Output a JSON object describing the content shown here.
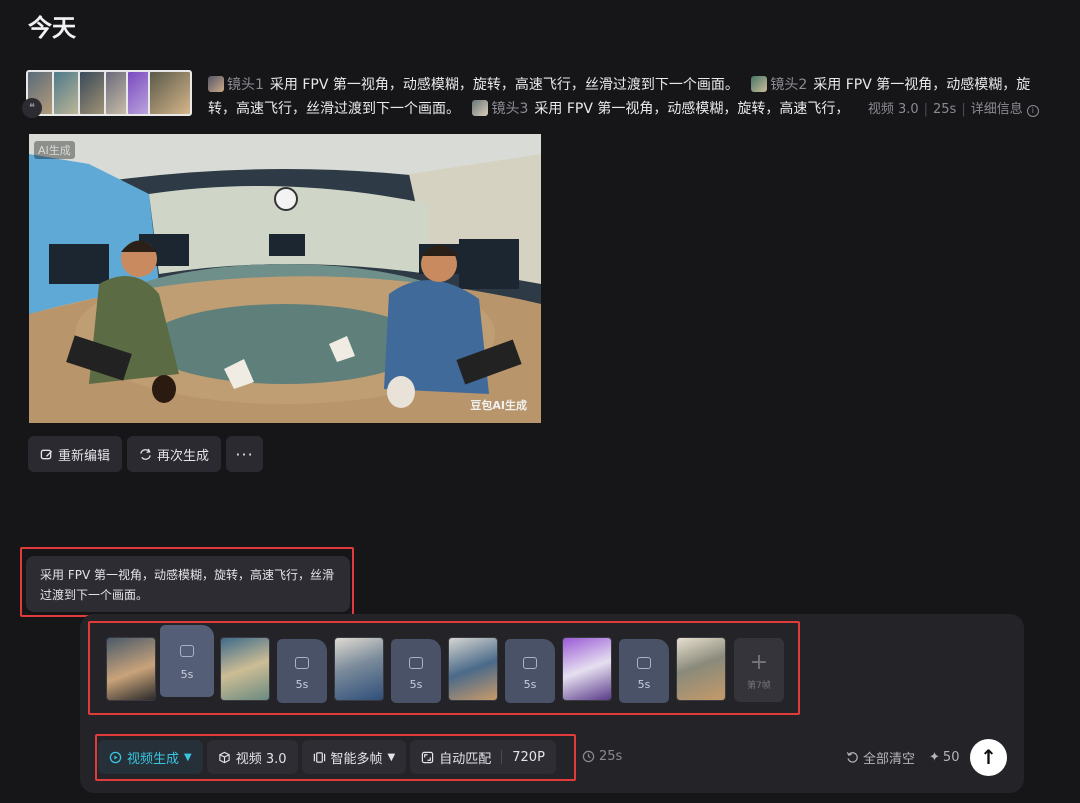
{
  "section": {
    "title": "今天"
  },
  "prompt": {
    "shots": [
      {
        "label": "镜头1",
        "text": "采用 FPV 第一视角，动感模糊，旋转，高速飞行，丝滑过渡到下一个画面。"
      },
      {
        "label": "镜头2",
        "text": "采用 FPV 第一视角，动感模糊，旋转，高速飞行，丝滑过渡到下一个画面。"
      },
      {
        "label": "镜头3",
        "text": "采用 FPV 第一视角，动感模糊，旋转，高速飞行，"
      }
    ],
    "model": "视频 3.0",
    "duration": "25s",
    "details_label": "详细信息"
  },
  "video": {
    "badge": "AI生成",
    "watermark": "豆包AI生成"
  },
  "actions": {
    "reedit": "重新编辑",
    "regenerate": "再次生成",
    "more": "···"
  },
  "tooltip": {
    "text": "采用 FPV 第一视角，动感模糊，旋转，高速飞行，丝滑过渡到下一个画面。"
  },
  "frames": {
    "gap_durations": [
      "5s",
      "5s",
      "5s",
      "5s",
      "5s"
    ],
    "add_label": "第7帧"
  },
  "toolbar": {
    "mode": "视频生成",
    "model": "视频 3.0",
    "frame_mode": "智能多帧",
    "ratio": "自动匹配",
    "resolution": "720P",
    "duration": "25s",
    "clear": "全部清空",
    "credits": "50"
  },
  "colors": {
    "accent": "#39c5e0",
    "highlight": "#e23b3b",
    "background": "#161619",
    "panel": "#232328"
  }
}
